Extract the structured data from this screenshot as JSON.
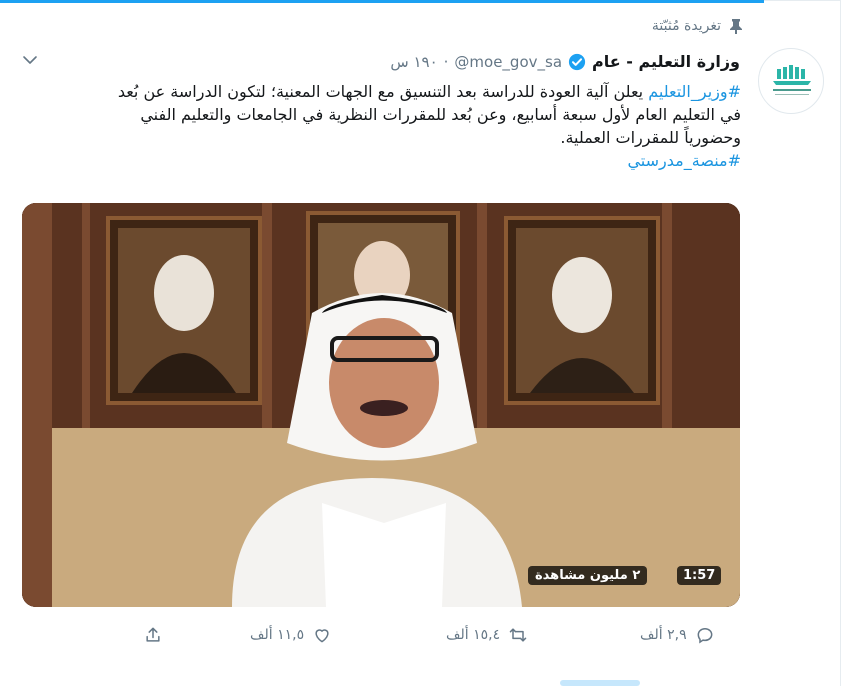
{
  "pinned_label": "تغريدة مُثبّتة",
  "author": {
    "name": "وزارة التعليم - عام",
    "handle": "@moe_gov_sa",
    "time": "١٩٠ س"
  },
  "tweet": {
    "hashtag1": "#وزير_التعليم",
    "text": " يعلن آلية العودة للدراسة بعد التنسيق مع الجهات المعنية؛ لتكون الدراسة عن بُعد في التعليم العام لأول سبعة أسابيع، وعن بُعد للمقررات النظرية في الجامعات والتعليم الفني وحضورياً للمقررات العملية.",
    "hashtag2": "#منصة_مدرستي"
  },
  "media": {
    "duration": "1:57",
    "views": "٢ مليون مشاهدة"
  },
  "actions": {
    "replies": "٢,٩ ألف",
    "retweets": "١٥,٤ ألف",
    "likes": "١١,٥ ألف"
  },
  "colors": {
    "accent": "#1da1f2",
    "link": "#1b95e0",
    "muted": "#657786",
    "verified": "#1da1f2"
  },
  "icons": [
    "pin-icon",
    "verified-icon",
    "chevron-down-icon",
    "reply-icon",
    "retweet-icon",
    "like-icon",
    "share-icon"
  ]
}
